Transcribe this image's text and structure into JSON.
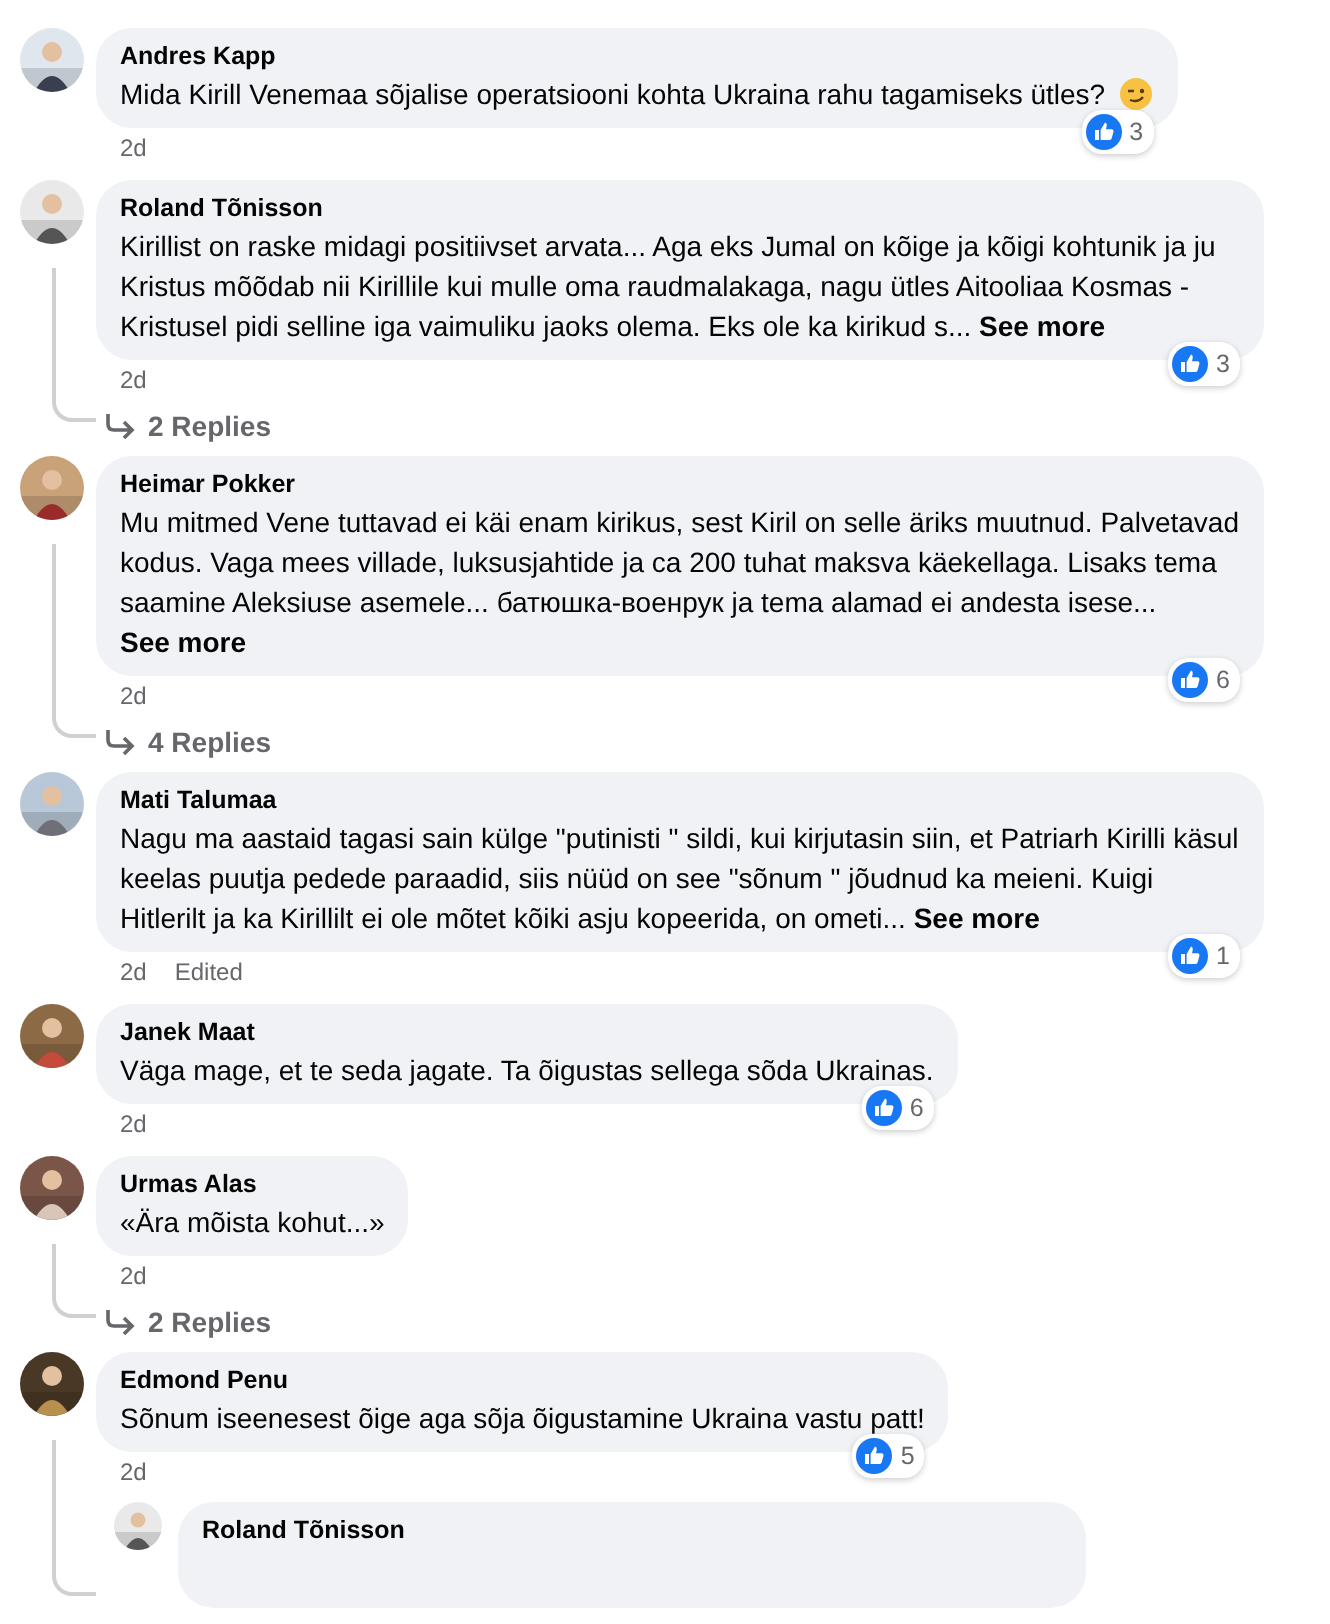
{
  "comments": [
    {
      "name": "Andres Kapp",
      "text": "Mida Kirill Venemaa sõjalise operatsiooni kohta Ukraina rahu tagamiseks ütles?",
      "emoji": true,
      "likes": "3",
      "time": "2d"
    },
    {
      "name": "Roland Tõnisson",
      "text": "Kirillist on raske midagi positiivset arvata... Aga eks Jumal on kõige ja kõigi kohtunik ja ju Kristus mõõdab nii Kirillile kui mulle oma raudmalakaga, nagu ütles Aitooliaa Kosmas - Kristusel pidi selline iga vaimuliku jaoks olema. Eks ole ka kirikud s...",
      "see_more": "See more",
      "likes": "3",
      "time": "2d",
      "replies": "2 Replies"
    },
    {
      "name": "Heimar Pokker",
      "text": "Mu mitmed Vene tuttavad ei käi enam kirikus, sest Kiril on selle äriks muutnud. Palvetavad kodus. Vaga mees villade, luksusjahtide ja ca 200 tuhat maksva käekellaga. Lisaks tema saamine Aleksiuse asemele... батюшка-военрук ja tema alamad ei andesta isese...",
      "see_more": "See more",
      "likes": "6",
      "time": "2d",
      "replies": "4 Replies"
    },
    {
      "name": "Mati Talumaa",
      "text": "Nagu ma aastaid tagasi sain külge \"putinisti \" sildi, kui kirjutasin siin, et Patriarh Kirilli käsul keelas puutja pedede paraadid, siis nüüd on see \"sõnum \" jõudnud ka meieni. Kuigi Hitlerilt ja ka Kirillilt ei ole mõtet kõiki asju kopeerida, on ometi...",
      "see_more": "See more",
      "likes": "1",
      "time": "2d",
      "edited": "Edited"
    },
    {
      "name": "Janek Maat",
      "text": "Väga mage, et te seda jagate. Ta õigustas sellega sõda Ukrainas.",
      "likes": "6",
      "time": "2d"
    },
    {
      "name": "Urmas Alas",
      "text": "«Ära mõista kohut...»",
      "time": "2d",
      "replies": "2 Replies"
    },
    {
      "name": "Edmond Penu",
      "text": "Sõnum iseenesest õige aga sõja õigustamine Ukraina vastu patt!",
      "likes": "5",
      "time": "2d",
      "nested": [
        {
          "name": "Roland Tõnisson"
        }
      ]
    }
  ]
}
